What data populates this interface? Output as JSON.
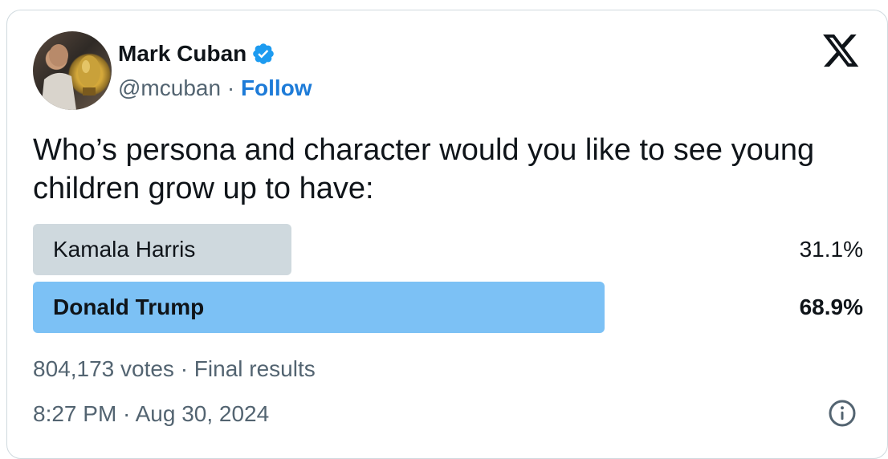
{
  "author": {
    "name": "Mark Cuban",
    "handle": "@mcuban",
    "separator": " · ",
    "follow_label": "Follow",
    "verified_icon": "verified-badge-icon",
    "verified_color": "#1d9bf0"
  },
  "tweet": {
    "text": "Who’s persona and character would you like to see young children grow up to have:"
  },
  "poll": {
    "options": [
      {
        "label": "Kamala Harris",
        "percent_text": "31.1%",
        "share": 0.311,
        "color": "#cfd9de",
        "winner": false
      },
      {
        "label": "Donald Trump",
        "percent_text": "68.9%",
        "share": 0.689,
        "color": "#7cc1f5",
        "winner": true
      }
    ],
    "summary": "804,173 votes · Final results"
  },
  "timestamp": "8:27 PM · Aug 30, 2024",
  "icons": {
    "brand": "x-logo-icon",
    "info": "info-icon"
  },
  "colors": {
    "accent": "#1d7bd8",
    "text_primary": "#0f1419",
    "text_secondary": "#536471",
    "border": "#cfd9de"
  }
}
